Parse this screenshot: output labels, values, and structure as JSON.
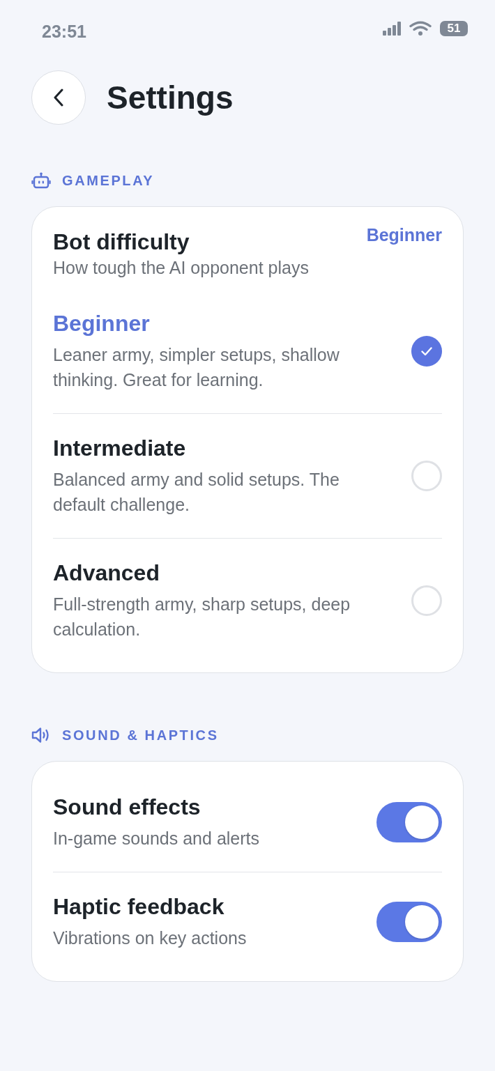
{
  "status_bar": {
    "time": "23:51",
    "battery": "51"
  },
  "header": {
    "title": "Settings"
  },
  "sections": [
    {
      "kind": "choice",
      "heading": "GAMEPLAY",
      "card": {
        "title": "Bot difficulty",
        "value": "Beginner",
        "subtitle": "How tough the AI opponent plays",
        "options": [
          {
            "label": "Beginner",
            "description": "Leaner army, simpler setups, shallow thinking. Great for learning.",
            "selected": true
          },
          {
            "label": "Intermediate",
            "description": "Balanced army and solid setups. The default challenge.",
            "selected": false
          },
          {
            "label": "Advanced",
            "description": "Full-strength army, sharp setups, deep calculation.",
            "selected": false
          }
        ]
      }
    },
    {
      "kind": "toggles",
      "heading": "SOUND & HAPTICS",
      "items": [
        {
          "label": "Sound effects",
          "description": "In-game sounds and alerts",
          "on": true
        },
        {
          "label": "Haptic feedback",
          "description": "Vibrations on key actions",
          "on": true
        }
      ]
    }
  ]
}
